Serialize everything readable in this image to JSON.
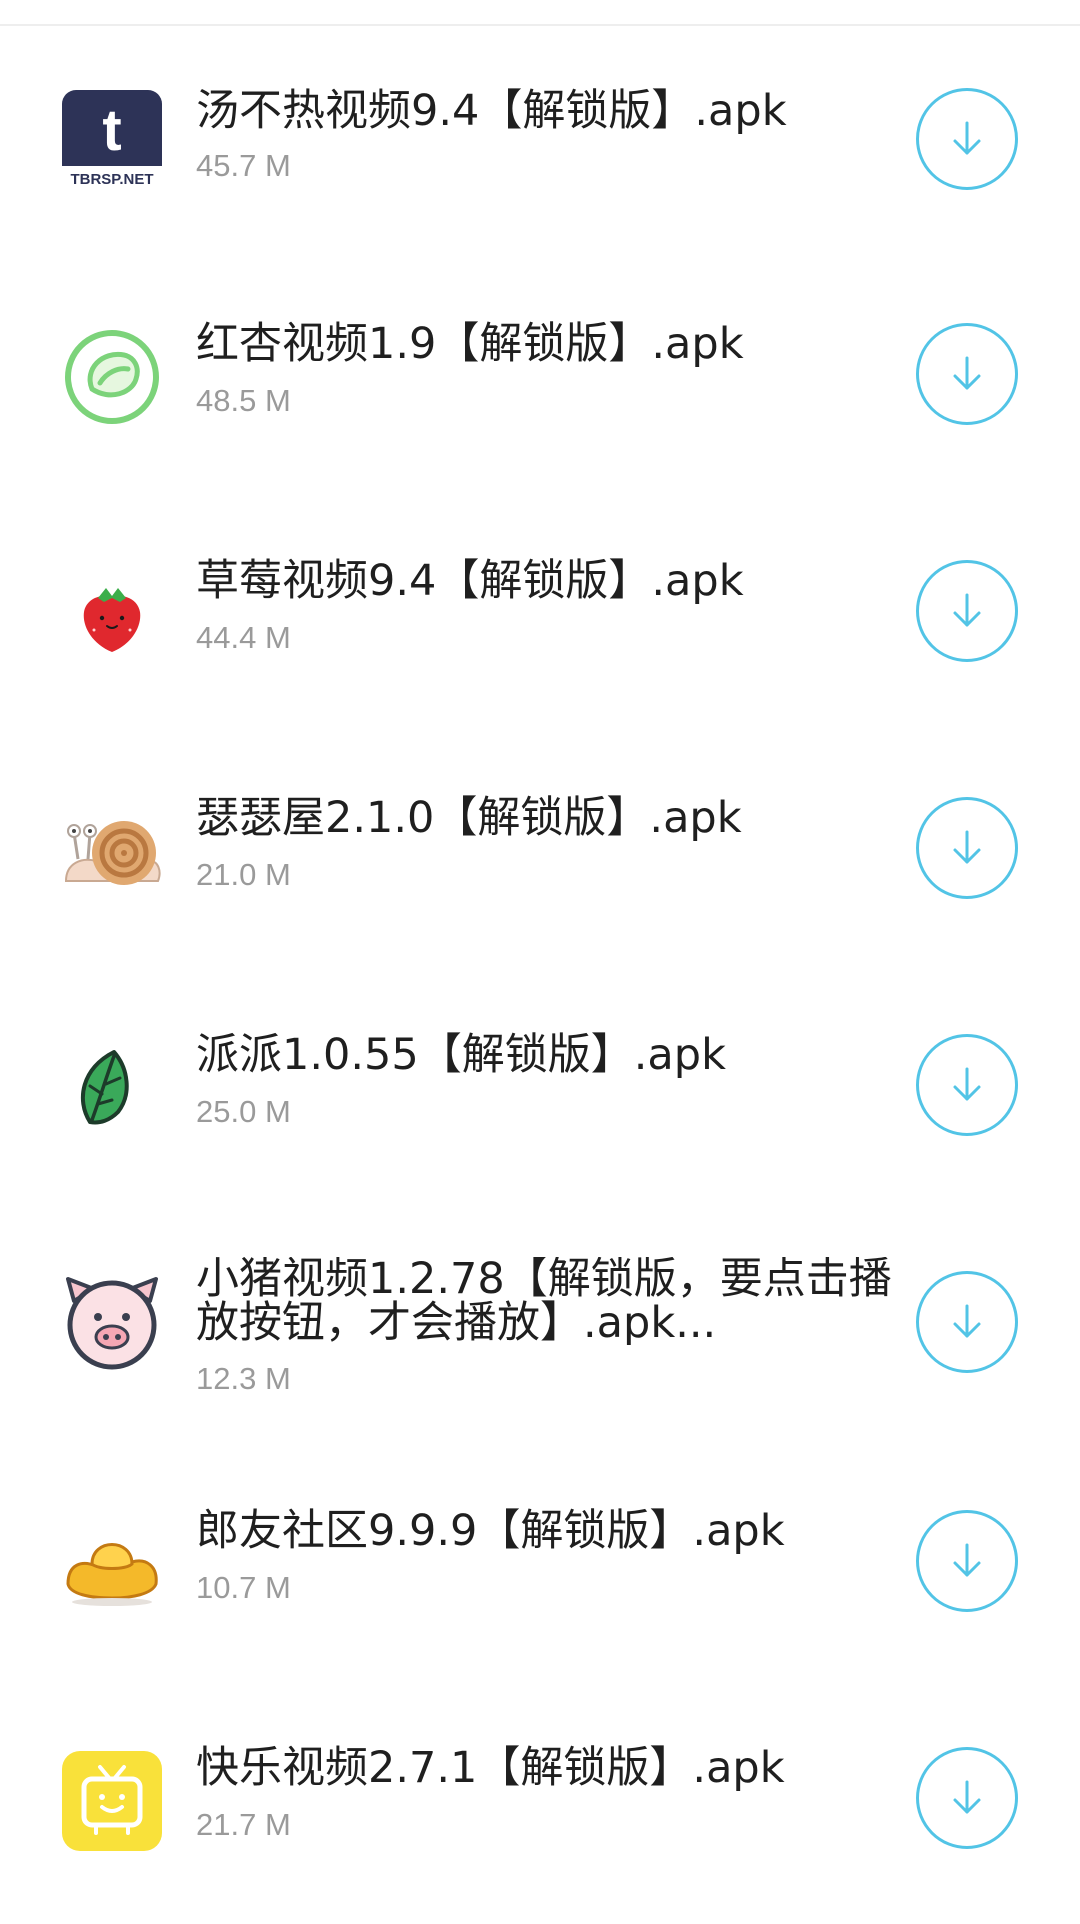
{
  "colors": {
    "accent": "#52c4e6",
    "title_text": "#1f1f1f",
    "size_text": "#9a9a9a"
  },
  "files": [
    {
      "name": "汤不热视频9.4【解锁版】.apk",
      "size": "45.7 M",
      "icon": "tumblr-tbrsp-icon",
      "icon_text": "t",
      "icon_caption": "TBRSP.NET"
    },
    {
      "name": "红杏视频1.9【解锁版】.apk",
      "size": "48.5 M",
      "icon": "apricot-fruit-icon"
    },
    {
      "name": "草莓视频9.4【解锁版】.apk",
      "size": "44.4 M",
      "icon": "strawberry-icon"
    },
    {
      "name": "瑟瑟屋2.1.0【解锁版】.apk",
      "size": "21.0 M",
      "icon": "snail-icon"
    },
    {
      "name": "派派1.0.55【解锁版】.apk",
      "size": "25.0 M",
      "icon": "green-leaf-icon"
    },
    {
      "name": "小猪视频1.2.78【解锁版，要点击播放按钮，才会播放】.apk...",
      "size": "12.3 M",
      "icon": "pig-face-icon"
    },
    {
      "name": "郎友社区9.9.9【解锁版】.apk",
      "size": "10.7 M",
      "icon": "gold-ingot-icon"
    },
    {
      "name": "快乐视频2.7.1【解锁版】.apk",
      "size": "21.7 M",
      "icon": "tv-smile-icon"
    }
  ],
  "download_icon": "download-arrow-icon"
}
